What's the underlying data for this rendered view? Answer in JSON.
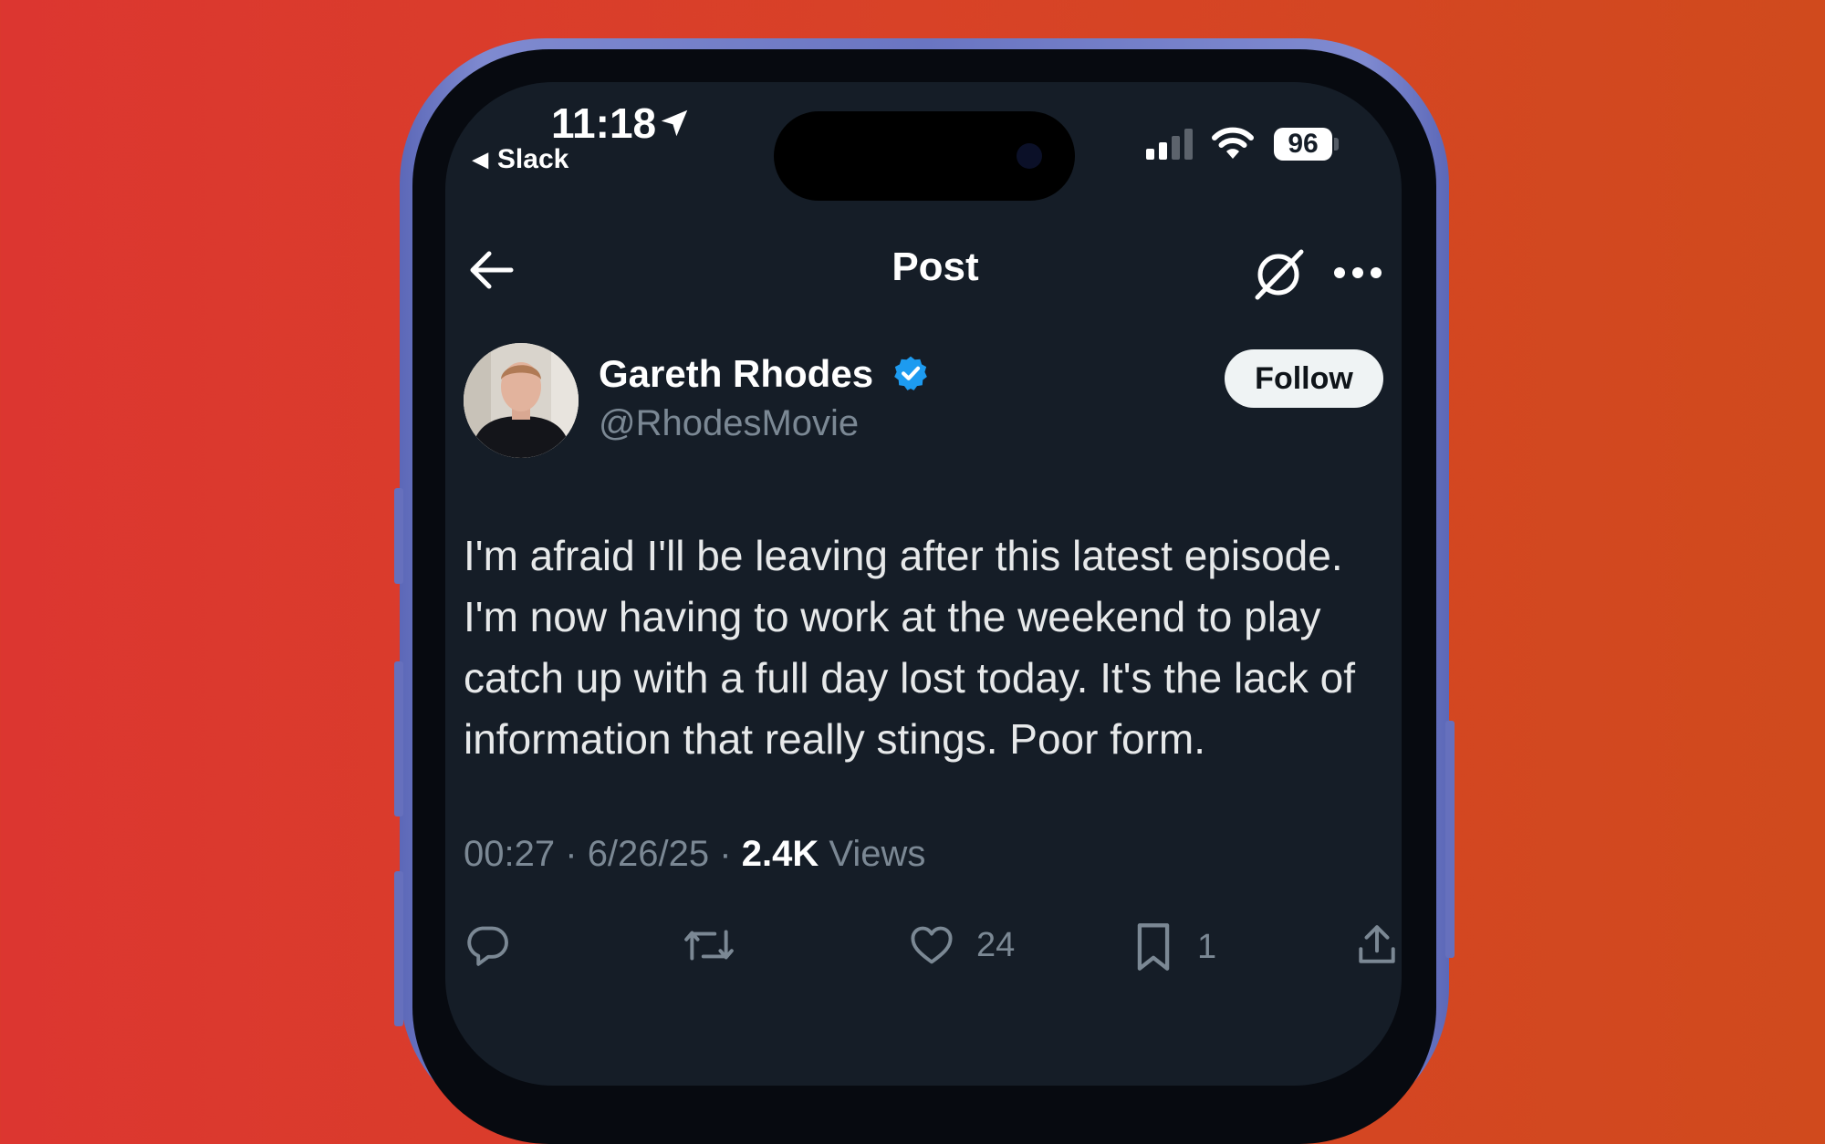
{
  "status_bar": {
    "time": "11:18",
    "back_app": "Slack",
    "battery": "96"
  },
  "header": {
    "title": "Post"
  },
  "author": {
    "name": "Gareth Rhodes",
    "handle": "@RhodesMovie",
    "verified": true,
    "follow_label": "Follow"
  },
  "post": {
    "text": "I'm afraid I'll be leaving after this latest episode. I'm now having to work at the weekend to play catch up with a full day lost today. It's the lack of information that really stings. Poor form.",
    "time": "00:27",
    "date": "6/26/25",
    "separator": "·",
    "views_count": "2.4K",
    "views_label": "Views"
  },
  "actions": {
    "likes": "24",
    "bookmarks": "1"
  },
  "icons": {
    "back": "arrow-left-icon",
    "grok": "grok-icon",
    "more": "more-icon",
    "verified": "verified-badge-icon",
    "reply": "reply-icon",
    "repost": "repost-icon",
    "like": "heart-icon",
    "bookmark": "bookmark-icon",
    "share": "share-icon",
    "location": "location-arrow-icon",
    "signal": "cellular-signal-icon",
    "wifi": "wifi-icon"
  },
  "colors": {
    "background": "#d84227",
    "phone_frame": "#6a75c2",
    "screen": "#151d27",
    "verified": "#1d9bf0",
    "muted_text": "#7b8894"
  }
}
